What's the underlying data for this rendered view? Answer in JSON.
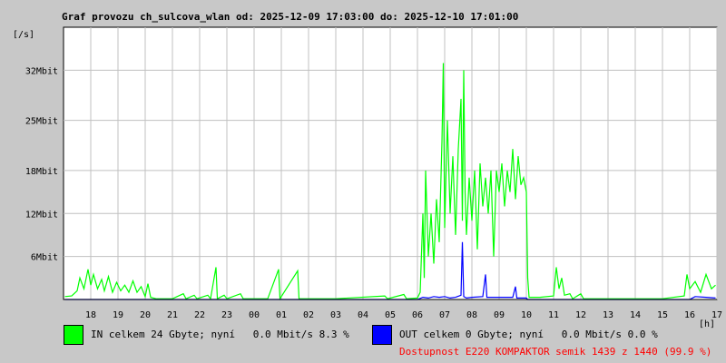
{
  "chart_data": {
    "type": "area",
    "title": "Graf provozu ch_sulcova_wlan od: 2025-12-09 17:03:00 do: 2025-12-10 17:01:00",
    "ylabel": "[/s]",
    "xlabel": "[h]",
    "grid": true,
    "legend_placement": "bottom",
    "ylim": [
      0,
      38
    ],
    "xlim": [
      17,
      41
    ],
    "y_ticks": [
      {
        "value": 6,
        "label": "6Mbit"
      },
      {
        "value": 12,
        "label": "12Mbit"
      },
      {
        "value": 18,
        "label": "18Mbit"
      },
      {
        "value": 25,
        "label": "25Mbit"
      },
      {
        "value": 32,
        "label": "32Mbit"
      }
    ],
    "x_ticks": [
      {
        "value": 18,
        "label": "18"
      },
      {
        "value": 19,
        "label": "19"
      },
      {
        "value": 20,
        "label": "20"
      },
      {
        "value": 21,
        "label": "21"
      },
      {
        "value": 22,
        "label": "22"
      },
      {
        "value": 23,
        "label": "23"
      },
      {
        "value": 24,
        "label": "00"
      },
      {
        "value": 25,
        "label": "01"
      },
      {
        "value": 26,
        "label": "02"
      },
      {
        "value": 27,
        "label": "03"
      },
      {
        "value": 28,
        "label": "04"
      },
      {
        "value": 29,
        "label": "05"
      },
      {
        "value": 30,
        "label": "06"
      },
      {
        "value": 31,
        "label": "07"
      },
      {
        "value": 32,
        "label": "08"
      },
      {
        "value": 33,
        "label": "09"
      },
      {
        "value": 34,
        "label": "10"
      },
      {
        "value": 35,
        "label": "11"
      },
      {
        "value": 36,
        "label": "12"
      },
      {
        "value": 37,
        "label": "13"
      },
      {
        "value": 38,
        "label": "14"
      },
      {
        "value": 39,
        "label": "15"
      },
      {
        "value": 40,
        "label": "16"
      },
      {
        "value": 41,
        "label": "17"
      }
    ],
    "series": [
      {
        "name": "IN",
        "color": "#00ff00",
        "points": [
          [
            17.05,
            0.4
          ],
          [
            17.3,
            0.5
          ],
          [
            17.5,
            1.2
          ],
          [
            17.6,
            3.0
          ],
          [
            17.75,
            1.5
          ],
          [
            17.9,
            4.2
          ],
          [
            18.0,
            2.0
          ],
          [
            18.1,
            3.5
          ],
          [
            18.25,
            1.5
          ],
          [
            18.4,
            2.8
          ],
          [
            18.5,
            1.2
          ],
          [
            18.65,
            3.2
          ],
          [
            18.8,
            1.0
          ],
          [
            18.95,
            2.4
          ],
          [
            19.1,
            1.2
          ],
          [
            19.25,
            2.0
          ],
          [
            19.4,
            1.0
          ],
          [
            19.55,
            2.6
          ],
          [
            19.7,
            1.0
          ],
          [
            19.85,
            1.8
          ],
          [
            20.0,
            0.4
          ],
          [
            20.1,
            2.2
          ],
          [
            20.2,
            0.3
          ],
          [
            20.4,
            0.1
          ],
          [
            21.0,
            0.1
          ],
          [
            21.4,
            0.8
          ],
          [
            21.5,
            0.1
          ],
          [
            21.8,
            0.6
          ],
          [
            21.9,
            0.1
          ],
          [
            22.3,
            0.6
          ],
          [
            22.4,
            0.1
          ],
          [
            22.6,
            4.5
          ],
          [
            22.65,
            0.1
          ],
          [
            22.9,
            0.6
          ],
          [
            23.0,
            0.1
          ],
          [
            23.5,
            0.8
          ],
          [
            23.6,
            0.1
          ],
          [
            24.5,
            0.1
          ],
          [
            24.9,
            4.2
          ],
          [
            24.95,
            0.1
          ],
          [
            25.6,
            4.0
          ],
          [
            25.65,
            0.1
          ],
          [
            27.0,
            0.1
          ],
          [
            28.8,
            0.5
          ],
          [
            28.9,
            0.1
          ],
          [
            29.5,
            0.7
          ],
          [
            29.6,
            0.1
          ],
          [
            30.0,
            0.2
          ],
          [
            30.1,
            1.0
          ],
          [
            30.2,
            12.0
          ],
          [
            30.25,
            3.0
          ],
          [
            30.3,
            18.0
          ],
          [
            30.4,
            6.0
          ],
          [
            30.5,
            12.0
          ],
          [
            30.6,
            5.0
          ],
          [
            30.7,
            14.0
          ],
          [
            30.8,
            8.0
          ],
          [
            30.9,
            22.0
          ],
          [
            30.95,
            33.0
          ],
          [
            31.0,
            10.0
          ],
          [
            31.1,
            25.0
          ],
          [
            31.2,
            12.0
          ],
          [
            31.3,
            20.0
          ],
          [
            31.4,
            9.0
          ],
          [
            31.5,
            21.0
          ],
          [
            31.6,
            28.0
          ],
          [
            31.65,
            11.0
          ],
          [
            31.7,
            32.0
          ],
          [
            31.75,
            15.0
          ],
          [
            31.8,
            9.0
          ],
          [
            31.9,
            17.0
          ],
          [
            32.0,
            11.0
          ],
          [
            32.1,
            18.0
          ],
          [
            32.2,
            7.0
          ],
          [
            32.3,
            19.0
          ],
          [
            32.4,
            13.0
          ],
          [
            32.5,
            17.0
          ],
          [
            32.6,
            12.0
          ],
          [
            32.7,
            18.0
          ],
          [
            32.8,
            6.0
          ],
          [
            32.9,
            18.0
          ],
          [
            33.0,
            15.0
          ],
          [
            33.1,
            19.0
          ],
          [
            33.2,
            13.0
          ],
          [
            33.3,
            18.0
          ],
          [
            33.4,
            15.0
          ],
          [
            33.5,
            21.0
          ],
          [
            33.6,
            14.0
          ],
          [
            33.7,
            20.0
          ],
          [
            33.8,
            16.0
          ],
          [
            33.9,
            17.0
          ],
          [
            34.0,
            15.0
          ],
          [
            34.05,
            3.0
          ],
          [
            34.1,
            0.3
          ],
          [
            34.5,
            0.3
          ],
          [
            35.0,
            0.5
          ],
          [
            35.1,
            4.5
          ],
          [
            35.2,
            1.5
          ],
          [
            35.3,
            3.0
          ],
          [
            35.4,
            0.6
          ],
          [
            35.6,
            0.8
          ],
          [
            35.7,
            0.1
          ],
          [
            36.0,
            0.8
          ],
          [
            36.1,
            0.1
          ],
          [
            39.0,
            0.1
          ],
          [
            39.8,
            0.5
          ],
          [
            39.9,
            3.5
          ],
          [
            40.0,
            1.5
          ],
          [
            40.2,
            2.5
          ],
          [
            40.4,
            1.0
          ],
          [
            40.6,
            3.5
          ],
          [
            40.8,
            1.5
          ],
          [
            40.95,
            2.0
          ]
        ]
      },
      {
        "name": "OUT",
        "color": "#0000ff",
        "points": [
          [
            17.05,
            0.0
          ],
          [
            30.0,
            0.0
          ],
          [
            30.2,
            0.3
          ],
          [
            30.4,
            0.2
          ],
          [
            30.6,
            0.4
          ],
          [
            30.8,
            0.3
          ],
          [
            31.0,
            0.4
          ],
          [
            31.2,
            0.2
          ],
          [
            31.4,
            0.3
          ],
          [
            31.6,
            0.6
          ],
          [
            31.65,
            8.0
          ],
          [
            31.7,
            0.4
          ],
          [
            31.8,
            0.2
          ],
          [
            32.0,
            0.3
          ],
          [
            32.4,
            0.4
          ],
          [
            32.5,
            3.5
          ],
          [
            32.55,
            0.3
          ],
          [
            33.0,
            0.3
          ],
          [
            33.5,
            0.3
          ],
          [
            33.6,
            1.8
          ],
          [
            33.65,
            0.2
          ],
          [
            34.0,
            0.2
          ],
          [
            34.05,
            0.0
          ],
          [
            40.0,
            0.0
          ],
          [
            40.2,
            0.4
          ],
          [
            40.6,
            0.3
          ],
          [
            40.95,
            0.2
          ]
        ]
      }
    ]
  },
  "legend": {
    "in": {
      "text": "IN celkem 24 Gbyte; nyní   0.0 Mbit/s 8.3 %",
      "color": "#00ff00"
    },
    "out": {
      "text": "OUT celkem 0 Gbyte; nyní   0.0 Mbit/s 0.0 %",
      "color": "#0000ff"
    },
    "availability": {
      "text": "Dostupnost E220 KOMPAKTOR semik 1439 z 1440 (99.9 %)",
      "color": "#ff0000"
    }
  }
}
